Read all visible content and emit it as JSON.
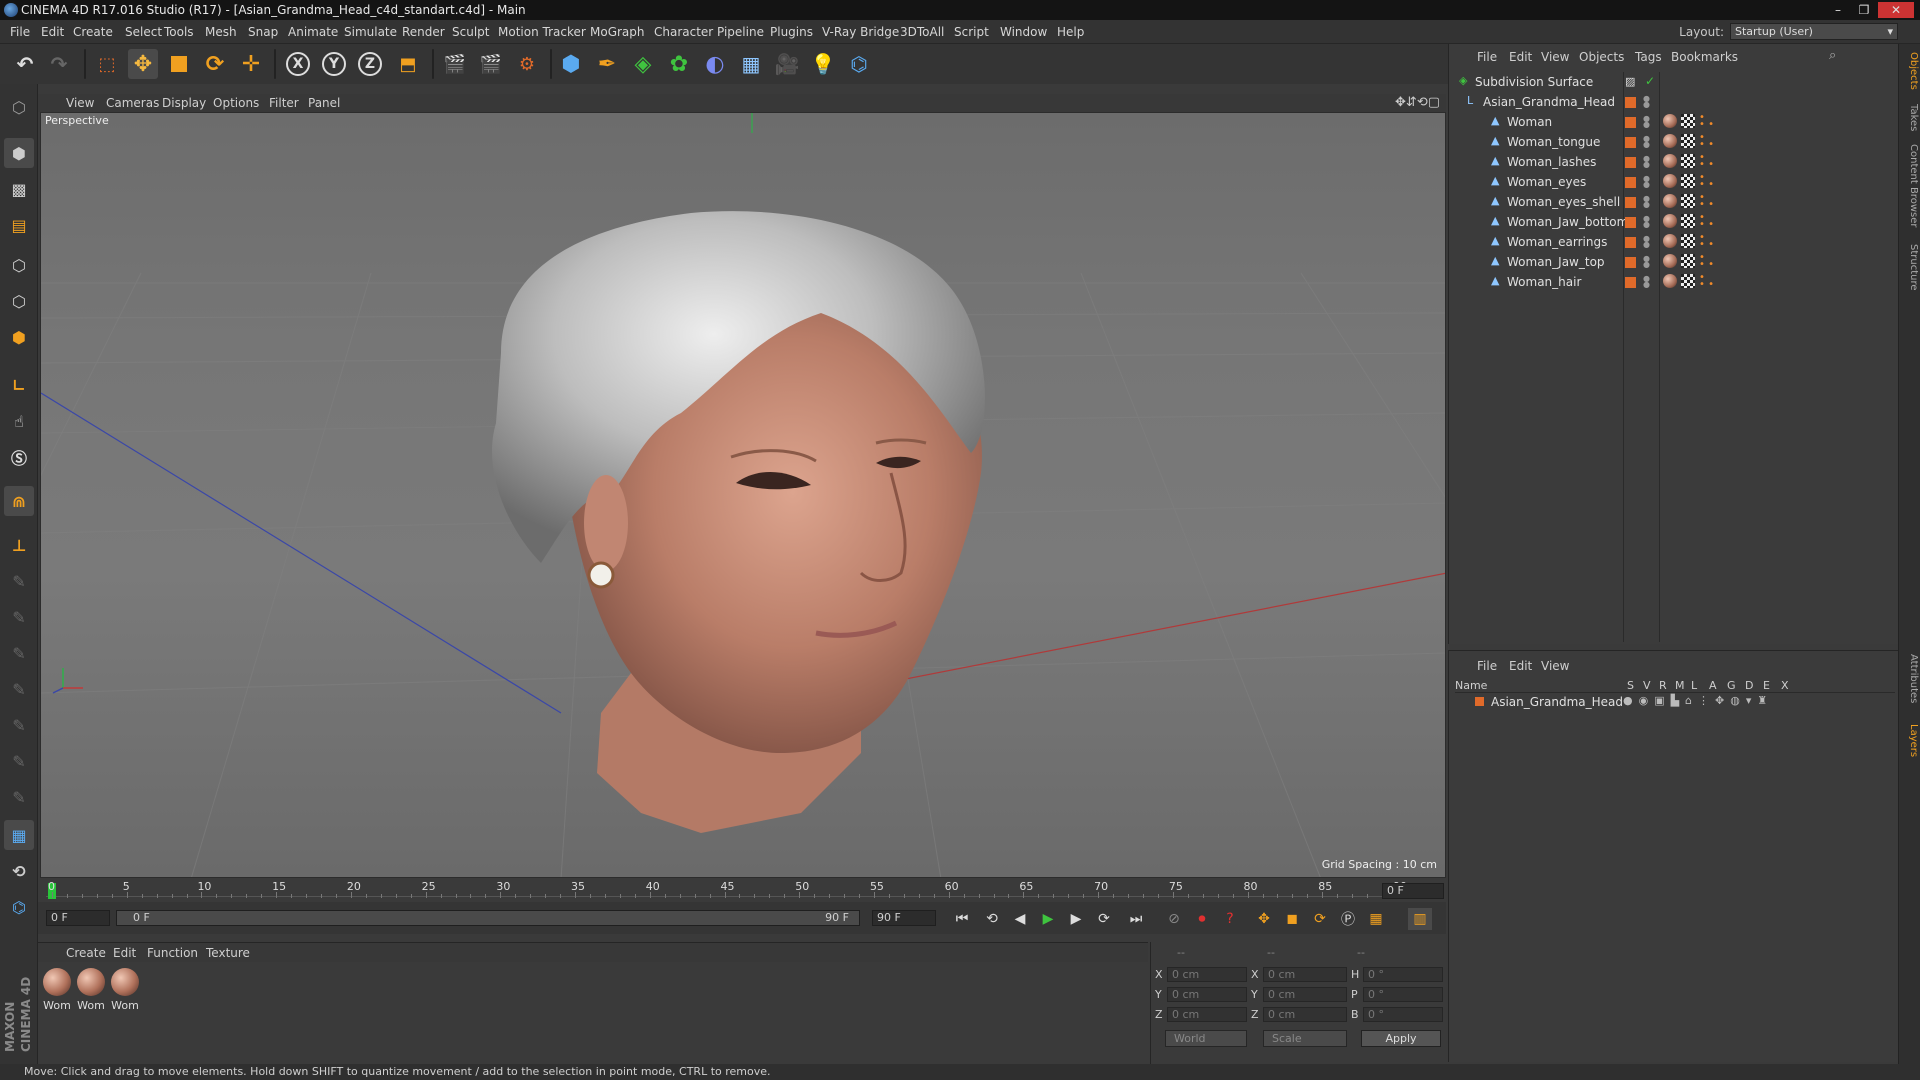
{
  "window": {
    "title": "CINEMA 4D R17.016 Studio (R17) - [Asian_Grandma_Head_c4d_standart.c4d] - Main",
    "controls": [
      "–",
      "❐",
      "✕"
    ]
  },
  "menubar": {
    "items": [
      "File",
      "Edit",
      "Create",
      "Select",
      "Tools",
      "Mesh",
      "Snap",
      "Animate",
      "Simulate",
      "Render",
      "Sculpt",
      "Motion Tracker",
      "MoGraph",
      "Character",
      "Pipeline",
      "Plugins",
      "V-Ray Bridge",
      "3DToAll",
      "Script",
      "Window",
      "Help"
    ],
    "layout_label": "Layout:",
    "layout_value": "Startup (User)"
  },
  "toolbar": {
    "axis_x": "X",
    "axis_y": "Y",
    "axis_z": "Z"
  },
  "viewport": {
    "menu": [
      "View",
      "Cameras",
      "Display",
      "Options",
      "Filter",
      "Panel"
    ],
    "camera": "Perspective",
    "grid_spacing": "Grid Spacing : 10 cm",
    "nav_icons": "✥⇵⟲▢"
  },
  "timeline": {
    "ticks": [
      "0",
      "5",
      "10",
      "15",
      "20",
      "25",
      "30",
      "35",
      "40",
      "45",
      "50",
      "55",
      "60",
      "65",
      "70",
      "75",
      "80",
      "85",
      "90"
    ],
    "current_frame": "0 F",
    "start_field": "0 F",
    "range_start": "0 F",
    "range_end": "90 F",
    "end_field": "90 F"
  },
  "materials": {
    "menu": [
      "Create",
      "Edit",
      "Function",
      "Texture"
    ],
    "items": [
      "Wom",
      "Wom",
      "Wom"
    ]
  },
  "coordinates": {
    "headers": [
      "--",
      "--",
      "--"
    ],
    "pos_labels": [
      "X",
      "Y",
      "Z"
    ],
    "pos_values": [
      "0 cm",
      "0 cm",
      "0 cm"
    ],
    "size_labels": [
      "X",
      "Y",
      "Z"
    ],
    "size_values": [
      "0 cm",
      "0 cm",
      "0 cm"
    ],
    "rot_labels": [
      "H",
      "P",
      "B"
    ],
    "rot_values": [
      "0 °",
      "0 °",
      "0 °"
    ],
    "space": "World",
    "mode": "Scale",
    "apply": "Apply"
  },
  "object_manager": {
    "menu": [
      "File",
      "Edit",
      "View",
      "Objects",
      "Tags",
      "Bookmarks"
    ],
    "root": "Subdivision Surface",
    "group": "Asian_Grandma_Head",
    "objects": [
      "Woman",
      "Woman_tongue",
      "Woman_lashes",
      "Woman_eyes",
      "Woman_eyes_shell",
      "Woman_Jaw_bottom",
      "Woman_earrings",
      "Woman_Jaw_top",
      "Woman_hair"
    ]
  },
  "layer_manager": {
    "menu": [
      "File",
      "Edit",
      "View"
    ],
    "columns": [
      "Name",
      "S",
      "V",
      "R",
      "M",
      "L",
      "A",
      "G",
      "D",
      "E",
      "X"
    ],
    "layers": [
      "Asian_Grandma_Head"
    ]
  },
  "side_tabs": [
    "Objects",
    "Takes",
    "Content Browser",
    "Structure",
    "Attributes",
    "Layers"
  ],
  "status": "Move: Click and drag to move elements. Hold down SHIFT to quantize movement / add to the selection in point mode, CTRL to remove.",
  "brand": "MAXON CINEMA 4D",
  "colors": {
    "accent_orange": "#e06a2a",
    "timeline_green": "#29c43a",
    "play_green": "#3fc43f"
  }
}
